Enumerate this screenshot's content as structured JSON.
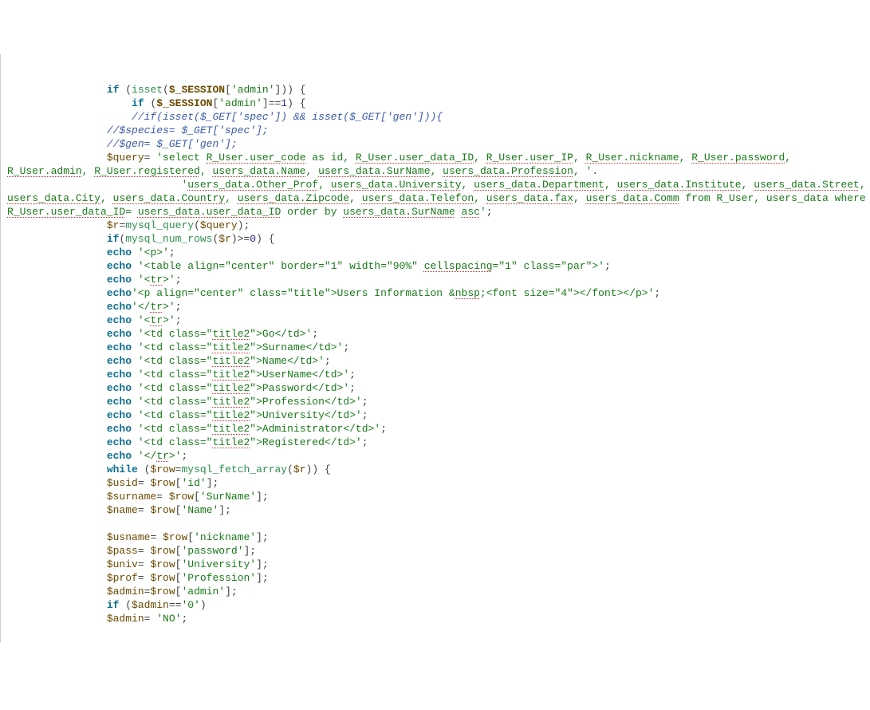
{
  "code_lines": [
    {
      "indent": 16,
      "tokens": [
        {
          "t": "kw",
          "v": "if"
        },
        {
          "t": "op",
          "v": " ("
        },
        {
          "t": "fn",
          "v": "isset"
        },
        {
          "t": "op",
          "v": "("
        },
        {
          "t": "global",
          "v": "$_SESSION"
        },
        {
          "t": "op",
          "v": "["
        },
        {
          "t": "str",
          "v": "'admin'"
        },
        {
          "t": "op",
          "v": "])) {"
        }
      ]
    },
    {
      "indent": 20,
      "tokens": [
        {
          "t": "kw",
          "v": "if"
        },
        {
          "t": "op",
          "v": " ("
        },
        {
          "t": "global",
          "v": "$_SESSION"
        },
        {
          "t": "op",
          "v": "["
        },
        {
          "t": "str",
          "v": "'admin'"
        },
        {
          "t": "op",
          "v": "]=="
        },
        {
          "t": "num",
          "v": "1"
        },
        {
          "t": "op",
          "v": ") {"
        }
      ]
    },
    {
      "indent": 20,
      "tokens": [
        {
          "t": "cmt",
          "v": "//if(isset($_GET['spec']) && isset($_GET['gen'])){"
        }
      ]
    },
    {
      "indent": 16,
      "tokens": [
        {
          "t": "cmt",
          "v": "//$species= $_GET['spec'];"
        }
      ]
    },
    {
      "indent": 16,
      "tokens": [
        {
          "t": "cmt",
          "v": "//$gen= $_GET['gen'];"
        }
      ]
    },
    {
      "indent": 16,
      "wrap": true,
      "tokens": [
        {
          "t": "var",
          "v": "$query"
        },
        {
          "t": "op",
          "v": "= "
        },
        {
          "t": "str",
          "v": "'select "
        },
        {
          "t": "str sq",
          "v": "R_User.user_code"
        },
        {
          "t": "str",
          "v": " as id, "
        },
        {
          "t": "str sq",
          "v": "R_User.user_data_ID"
        },
        {
          "t": "str",
          "v": ", "
        },
        {
          "t": "str sq",
          "v": "R_User.user_IP"
        },
        {
          "t": "str",
          "v": ", "
        },
        {
          "t": "str sq",
          "v": "R_User.nickname"
        },
        {
          "t": "str",
          "v": ", "
        },
        {
          "t": "str sq",
          "v": "R_User.password"
        },
        {
          "t": "str",
          "v": ", "
        },
        {
          "t": "str sq",
          "v": "R_User.admin"
        },
        {
          "t": "str",
          "v": ", "
        },
        {
          "t": "str sq",
          "v": "R_User.registered"
        },
        {
          "t": "str",
          "v": ", "
        },
        {
          "t": "str sq",
          "v": "users_data.Name"
        },
        {
          "t": "str",
          "v": ", "
        },
        {
          "t": "str sq",
          "v": "users_data.SurName"
        },
        {
          "t": "str",
          "v": ", "
        },
        {
          "t": "str sq",
          "v": "users_data.Profession"
        },
        {
          "t": "str",
          "v": ", '"
        },
        {
          "t": "op",
          "v": "."
        }
      ]
    },
    {
      "indent": 28,
      "wrap": true,
      "tokens": [
        {
          "t": "str",
          "v": "'"
        },
        {
          "t": "str sq",
          "v": "users_data.Other_Prof"
        },
        {
          "t": "str",
          "v": ", "
        },
        {
          "t": "str sq",
          "v": "users_data.University"
        },
        {
          "t": "str",
          "v": ", "
        },
        {
          "t": "str sq",
          "v": "users_data.Department"
        },
        {
          "t": "str",
          "v": ", "
        },
        {
          "t": "str sq",
          "v": "users_data.Institute"
        },
        {
          "t": "str",
          "v": ", "
        },
        {
          "t": "str sq",
          "v": "users_data.Street"
        },
        {
          "t": "str",
          "v": ", "
        },
        {
          "t": "str sq",
          "v": "users_data.City"
        },
        {
          "t": "str",
          "v": ", "
        },
        {
          "t": "str sq",
          "v": "users_data.Country"
        },
        {
          "t": "str",
          "v": ", "
        },
        {
          "t": "str sq",
          "v": "users_data.Zipcode"
        },
        {
          "t": "str",
          "v": ", "
        },
        {
          "t": "str sq",
          "v": "users_data.Telefon"
        },
        {
          "t": "str",
          "v": ", "
        },
        {
          "t": "str sq",
          "v": "users_data.fax"
        },
        {
          "t": "str",
          "v": ", "
        },
        {
          "t": "str sq",
          "v": "users_data.Comm"
        },
        {
          "t": "str",
          "v": " from R_User, users_data where "
        },
        {
          "t": "str sq",
          "v": "R_User.user_data_ID"
        },
        {
          "t": "str",
          "v": "= "
        },
        {
          "t": "str sq",
          "v": "users_data.user_data_ID"
        },
        {
          "t": "str",
          "v": " order by "
        },
        {
          "t": "str sq",
          "v": "users_data.SurName"
        },
        {
          "t": "str",
          "v": " "
        },
        {
          "t": "str sq",
          "v": "asc"
        },
        {
          "t": "str",
          "v": "'"
        },
        {
          "t": "op",
          "v": ";"
        }
      ]
    },
    {
      "indent": 16,
      "tokens": [
        {
          "t": "var",
          "v": "$r"
        },
        {
          "t": "op",
          "v": "="
        },
        {
          "t": "fn",
          "v": "mysql_query"
        },
        {
          "t": "op",
          "v": "("
        },
        {
          "t": "var",
          "v": "$query"
        },
        {
          "t": "op",
          "v": ");"
        }
      ]
    },
    {
      "indent": 16,
      "tokens": [
        {
          "t": "kw",
          "v": "if"
        },
        {
          "t": "op",
          "v": "("
        },
        {
          "t": "fn",
          "v": "mysql_num_rows"
        },
        {
          "t": "op",
          "v": "("
        },
        {
          "t": "var",
          "v": "$r"
        },
        {
          "t": "op",
          "v": ")>="
        },
        {
          "t": "num",
          "v": "0"
        },
        {
          "t": "op",
          "v": ") {"
        }
      ]
    },
    {
      "indent": 16,
      "tokens": [
        {
          "t": "kw",
          "v": "echo"
        },
        {
          "t": "op",
          "v": " "
        },
        {
          "t": "str",
          "v": "'<p>'"
        },
        {
          "t": "op",
          "v": ";"
        }
      ]
    },
    {
      "indent": 16,
      "tokens": [
        {
          "t": "kw",
          "v": "echo"
        },
        {
          "t": "op",
          "v": " "
        },
        {
          "t": "str",
          "v": "'<table align=\"center\" border=\"1\" width=\"90%\" "
        },
        {
          "t": "str sq",
          "v": "cellspacing"
        },
        {
          "t": "str",
          "v": "=\"1\" class=\"par\">'"
        },
        {
          "t": "op",
          "v": ";"
        }
      ]
    },
    {
      "indent": 16,
      "tokens": [
        {
          "t": "kw",
          "v": "echo"
        },
        {
          "t": "op",
          "v": " "
        },
        {
          "t": "str",
          "v": "'<"
        },
        {
          "t": "str sq",
          "v": "tr"
        },
        {
          "t": "str",
          "v": ">'"
        },
        {
          "t": "op",
          "v": ";"
        }
      ]
    },
    {
      "indent": 16,
      "tokens": [
        {
          "t": "kw",
          "v": "echo"
        },
        {
          "t": "str",
          "v": "'<p align=\"center\" class=\"title\">Users Information &"
        },
        {
          "t": "str sq",
          "v": "nbsp"
        },
        {
          "t": "str",
          "v": ";<font size=\"4\"></font></p>'"
        },
        {
          "t": "op",
          "v": ";"
        }
      ]
    },
    {
      "indent": 16,
      "tokens": [
        {
          "t": "kw",
          "v": "echo"
        },
        {
          "t": "str",
          "v": "'</"
        },
        {
          "t": "str sq",
          "v": "tr"
        },
        {
          "t": "str",
          "v": ">'"
        },
        {
          "t": "op",
          "v": ";"
        }
      ]
    },
    {
      "indent": 16,
      "tokens": [
        {
          "t": "kw",
          "v": "echo"
        },
        {
          "t": "op",
          "v": " "
        },
        {
          "t": "str",
          "v": "'<"
        },
        {
          "t": "str sq",
          "v": "tr"
        },
        {
          "t": "str",
          "v": ">'"
        },
        {
          "t": "op",
          "v": ";"
        }
      ]
    },
    {
      "indent": 16,
      "tokens": [
        {
          "t": "kw",
          "v": "echo"
        },
        {
          "t": "op",
          "v": " "
        },
        {
          "t": "str",
          "v": "'<td class=\""
        },
        {
          "t": "str sq",
          "v": "title2"
        },
        {
          "t": "str",
          "v": "\">Go</td>'"
        },
        {
          "t": "op",
          "v": ";"
        }
      ]
    },
    {
      "indent": 16,
      "tokens": [
        {
          "t": "kw",
          "v": "echo"
        },
        {
          "t": "op",
          "v": " "
        },
        {
          "t": "str",
          "v": "'<td class=\""
        },
        {
          "t": "str sq",
          "v": "title2"
        },
        {
          "t": "str",
          "v": "\">Surname</td>'"
        },
        {
          "t": "op",
          "v": ";"
        }
      ]
    },
    {
      "indent": 16,
      "tokens": [
        {
          "t": "kw",
          "v": "echo"
        },
        {
          "t": "op",
          "v": " "
        },
        {
          "t": "str",
          "v": "'<td class=\""
        },
        {
          "t": "str sq",
          "v": "title2"
        },
        {
          "t": "str",
          "v": "\">Name</td>'"
        },
        {
          "t": "op",
          "v": ";"
        }
      ]
    },
    {
      "indent": 16,
      "tokens": [
        {
          "t": "kw",
          "v": "echo"
        },
        {
          "t": "op",
          "v": " "
        },
        {
          "t": "str",
          "v": "'<td class=\""
        },
        {
          "t": "str sq",
          "v": "title2"
        },
        {
          "t": "str",
          "v": "\">UserName</td>'"
        },
        {
          "t": "op",
          "v": ";"
        }
      ]
    },
    {
      "indent": 16,
      "tokens": [
        {
          "t": "kw",
          "v": "echo"
        },
        {
          "t": "op",
          "v": " "
        },
        {
          "t": "str",
          "v": "'<td class=\""
        },
        {
          "t": "str sq",
          "v": "title2"
        },
        {
          "t": "str",
          "v": "\">Password</td>'"
        },
        {
          "t": "op",
          "v": ";"
        }
      ]
    },
    {
      "indent": 16,
      "tokens": [
        {
          "t": "kw",
          "v": "echo"
        },
        {
          "t": "op",
          "v": " "
        },
        {
          "t": "str",
          "v": "'<td class=\""
        },
        {
          "t": "str sq",
          "v": "title2"
        },
        {
          "t": "str",
          "v": "\">Profession</td>'"
        },
        {
          "t": "op",
          "v": ";"
        }
      ]
    },
    {
      "indent": 16,
      "tokens": [
        {
          "t": "kw",
          "v": "echo"
        },
        {
          "t": "op",
          "v": " "
        },
        {
          "t": "str",
          "v": "'<td class=\""
        },
        {
          "t": "str sq",
          "v": "title2"
        },
        {
          "t": "str",
          "v": "\">University</td>'"
        },
        {
          "t": "op",
          "v": ";"
        }
      ]
    },
    {
      "indent": 16,
      "tokens": [
        {
          "t": "kw",
          "v": "echo"
        },
        {
          "t": "op",
          "v": " "
        },
        {
          "t": "str",
          "v": "'<td class=\""
        },
        {
          "t": "str sq",
          "v": "title2"
        },
        {
          "t": "str",
          "v": "\">Administrator</td>'"
        },
        {
          "t": "op",
          "v": ";"
        }
      ]
    },
    {
      "indent": 16,
      "tokens": [
        {
          "t": "kw",
          "v": "echo"
        },
        {
          "t": "op",
          "v": " "
        },
        {
          "t": "str",
          "v": "'<td class=\""
        },
        {
          "t": "str sq",
          "v": "title2"
        },
        {
          "t": "str",
          "v": "\">Registered</td>'"
        },
        {
          "t": "op",
          "v": ";"
        }
      ]
    },
    {
      "indent": 16,
      "tokens": [
        {
          "t": "kw",
          "v": "echo"
        },
        {
          "t": "op",
          "v": " "
        },
        {
          "t": "str",
          "v": "'</"
        },
        {
          "t": "str sq",
          "v": "tr"
        },
        {
          "t": "str",
          "v": ">'"
        },
        {
          "t": "op",
          "v": ";"
        }
      ]
    },
    {
      "indent": 16,
      "tokens": [
        {
          "t": "kw",
          "v": "while"
        },
        {
          "t": "op",
          "v": " ("
        },
        {
          "t": "var",
          "v": "$row"
        },
        {
          "t": "op",
          "v": "="
        },
        {
          "t": "fn",
          "v": "mysql_fetch_array"
        },
        {
          "t": "op",
          "v": "("
        },
        {
          "t": "var",
          "v": "$r"
        },
        {
          "t": "op",
          "v": ")) {"
        }
      ]
    },
    {
      "indent": 16,
      "tokens": [
        {
          "t": "var",
          "v": "$usid"
        },
        {
          "t": "op",
          "v": "= "
        },
        {
          "t": "var",
          "v": "$row"
        },
        {
          "t": "op",
          "v": "["
        },
        {
          "t": "str",
          "v": "'id'"
        },
        {
          "t": "op",
          "v": "];"
        }
      ]
    },
    {
      "indent": 16,
      "tokens": [
        {
          "t": "var",
          "v": "$surname"
        },
        {
          "t": "op",
          "v": "= "
        },
        {
          "t": "var",
          "v": "$row"
        },
        {
          "t": "op",
          "v": "["
        },
        {
          "t": "str",
          "v": "'SurName'"
        },
        {
          "t": "op",
          "v": "];"
        }
      ]
    },
    {
      "indent": 16,
      "tokens": [
        {
          "t": "var",
          "v": "$name"
        },
        {
          "t": "op",
          "v": "= "
        },
        {
          "t": "var",
          "v": "$row"
        },
        {
          "t": "op",
          "v": "["
        },
        {
          "t": "str",
          "v": "'Name'"
        },
        {
          "t": "op",
          "v": "];"
        }
      ]
    },
    {
      "indent": 16,
      "tokens": []
    },
    {
      "indent": 16,
      "tokens": [
        {
          "t": "var",
          "v": "$usname"
        },
        {
          "t": "op",
          "v": "= "
        },
        {
          "t": "var",
          "v": "$row"
        },
        {
          "t": "op",
          "v": "["
        },
        {
          "t": "str",
          "v": "'nickname'"
        },
        {
          "t": "op",
          "v": "];"
        }
      ]
    },
    {
      "indent": 16,
      "tokens": [
        {
          "t": "var",
          "v": "$pass"
        },
        {
          "t": "op",
          "v": "= "
        },
        {
          "t": "var",
          "v": "$row"
        },
        {
          "t": "op",
          "v": "["
        },
        {
          "t": "str",
          "v": "'password'"
        },
        {
          "t": "op",
          "v": "];"
        }
      ]
    },
    {
      "indent": 16,
      "tokens": [
        {
          "t": "var",
          "v": "$univ"
        },
        {
          "t": "op",
          "v": "= "
        },
        {
          "t": "var",
          "v": "$row"
        },
        {
          "t": "op",
          "v": "["
        },
        {
          "t": "str",
          "v": "'University'"
        },
        {
          "t": "op",
          "v": "];"
        }
      ]
    },
    {
      "indent": 16,
      "tokens": [
        {
          "t": "var",
          "v": "$prof"
        },
        {
          "t": "op",
          "v": "= "
        },
        {
          "t": "var",
          "v": "$row"
        },
        {
          "t": "op",
          "v": "["
        },
        {
          "t": "str",
          "v": "'Profession'"
        },
        {
          "t": "op",
          "v": "];"
        }
      ]
    },
    {
      "indent": 16,
      "tokens": [
        {
          "t": "var",
          "v": "$admin"
        },
        {
          "t": "op",
          "v": "="
        },
        {
          "t": "var",
          "v": "$row"
        },
        {
          "t": "op",
          "v": "["
        },
        {
          "t": "str",
          "v": "'admin'"
        },
        {
          "t": "op",
          "v": "];"
        }
      ]
    },
    {
      "indent": 16,
      "tokens": [
        {
          "t": "kw",
          "v": "if"
        },
        {
          "t": "op",
          "v": " ("
        },
        {
          "t": "var",
          "v": "$admin"
        },
        {
          "t": "op",
          "v": "=="
        },
        {
          "t": "str",
          "v": "'0'"
        },
        {
          "t": "op",
          "v": ")"
        }
      ]
    },
    {
      "indent": 16,
      "tokens": [
        {
          "t": "var",
          "v": "$admin"
        },
        {
          "t": "op",
          "v": "= "
        },
        {
          "t": "str",
          "v": "'NO'"
        },
        {
          "t": "op",
          "v": ";"
        }
      ]
    }
  ]
}
